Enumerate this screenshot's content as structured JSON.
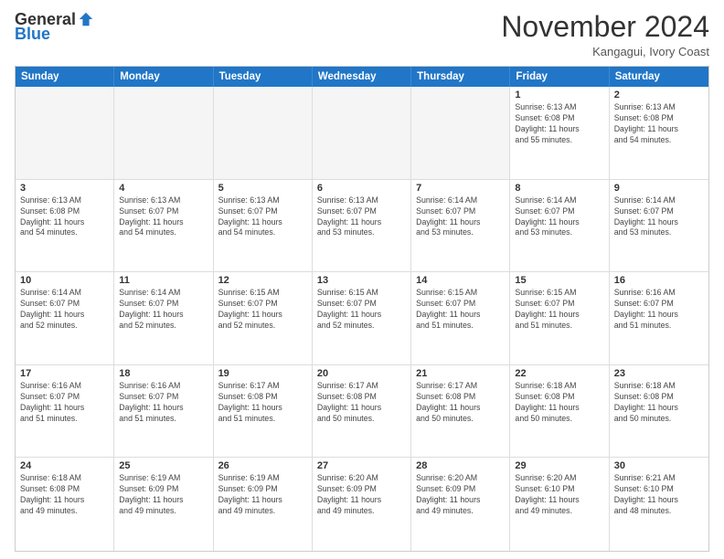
{
  "header": {
    "logo_general": "General",
    "logo_blue": "Blue",
    "month_title": "November 2024",
    "location": "Kangagui, Ivory Coast"
  },
  "calendar": {
    "days_of_week": [
      "Sunday",
      "Monday",
      "Tuesday",
      "Wednesday",
      "Thursday",
      "Friday",
      "Saturday"
    ],
    "weeks": [
      [
        {
          "day": "",
          "info": ""
        },
        {
          "day": "",
          "info": ""
        },
        {
          "day": "",
          "info": ""
        },
        {
          "day": "",
          "info": ""
        },
        {
          "day": "",
          "info": ""
        },
        {
          "day": "1",
          "info": "Sunrise: 6:13 AM\nSunset: 6:08 PM\nDaylight: 11 hours\nand 55 minutes."
        },
        {
          "day": "2",
          "info": "Sunrise: 6:13 AM\nSunset: 6:08 PM\nDaylight: 11 hours\nand 54 minutes."
        }
      ],
      [
        {
          "day": "3",
          "info": "Sunrise: 6:13 AM\nSunset: 6:08 PM\nDaylight: 11 hours\nand 54 minutes."
        },
        {
          "day": "4",
          "info": "Sunrise: 6:13 AM\nSunset: 6:07 PM\nDaylight: 11 hours\nand 54 minutes."
        },
        {
          "day": "5",
          "info": "Sunrise: 6:13 AM\nSunset: 6:07 PM\nDaylight: 11 hours\nand 54 minutes."
        },
        {
          "day": "6",
          "info": "Sunrise: 6:13 AM\nSunset: 6:07 PM\nDaylight: 11 hours\nand 53 minutes."
        },
        {
          "day": "7",
          "info": "Sunrise: 6:14 AM\nSunset: 6:07 PM\nDaylight: 11 hours\nand 53 minutes."
        },
        {
          "day": "8",
          "info": "Sunrise: 6:14 AM\nSunset: 6:07 PM\nDaylight: 11 hours\nand 53 minutes."
        },
        {
          "day": "9",
          "info": "Sunrise: 6:14 AM\nSunset: 6:07 PM\nDaylight: 11 hours\nand 53 minutes."
        }
      ],
      [
        {
          "day": "10",
          "info": "Sunrise: 6:14 AM\nSunset: 6:07 PM\nDaylight: 11 hours\nand 52 minutes."
        },
        {
          "day": "11",
          "info": "Sunrise: 6:14 AM\nSunset: 6:07 PM\nDaylight: 11 hours\nand 52 minutes."
        },
        {
          "day": "12",
          "info": "Sunrise: 6:15 AM\nSunset: 6:07 PM\nDaylight: 11 hours\nand 52 minutes."
        },
        {
          "day": "13",
          "info": "Sunrise: 6:15 AM\nSunset: 6:07 PM\nDaylight: 11 hours\nand 52 minutes."
        },
        {
          "day": "14",
          "info": "Sunrise: 6:15 AM\nSunset: 6:07 PM\nDaylight: 11 hours\nand 51 minutes."
        },
        {
          "day": "15",
          "info": "Sunrise: 6:15 AM\nSunset: 6:07 PM\nDaylight: 11 hours\nand 51 minutes."
        },
        {
          "day": "16",
          "info": "Sunrise: 6:16 AM\nSunset: 6:07 PM\nDaylight: 11 hours\nand 51 minutes."
        }
      ],
      [
        {
          "day": "17",
          "info": "Sunrise: 6:16 AM\nSunset: 6:07 PM\nDaylight: 11 hours\nand 51 minutes."
        },
        {
          "day": "18",
          "info": "Sunrise: 6:16 AM\nSunset: 6:07 PM\nDaylight: 11 hours\nand 51 minutes."
        },
        {
          "day": "19",
          "info": "Sunrise: 6:17 AM\nSunset: 6:08 PM\nDaylight: 11 hours\nand 51 minutes."
        },
        {
          "day": "20",
          "info": "Sunrise: 6:17 AM\nSunset: 6:08 PM\nDaylight: 11 hours\nand 50 minutes."
        },
        {
          "day": "21",
          "info": "Sunrise: 6:17 AM\nSunset: 6:08 PM\nDaylight: 11 hours\nand 50 minutes."
        },
        {
          "day": "22",
          "info": "Sunrise: 6:18 AM\nSunset: 6:08 PM\nDaylight: 11 hours\nand 50 minutes."
        },
        {
          "day": "23",
          "info": "Sunrise: 6:18 AM\nSunset: 6:08 PM\nDaylight: 11 hours\nand 50 minutes."
        }
      ],
      [
        {
          "day": "24",
          "info": "Sunrise: 6:18 AM\nSunset: 6:08 PM\nDaylight: 11 hours\nand 49 minutes."
        },
        {
          "day": "25",
          "info": "Sunrise: 6:19 AM\nSunset: 6:09 PM\nDaylight: 11 hours\nand 49 minutes."
        },
        {
          "day": "26",
          "info": "Sunrise: 6:19 AM\nSunset: 6:09 PM\nDaylight: 11 hours\nand 49 minutes."
        },
        {
          "day": "27",
          "info": "Sunrise: 6:20 AM\nSunset: 6:09 PM\nDaylight: 11 hours\nand 49 minutes."
        },
        {
          "day": "28",
          "info": "Sunrise: 6:20 AM\nSunset: 6:09 PM\nDaylight: 11 hours\nand 49 minutes."
        },
        {
          "day": "29",
          "info": "Sunrise: 6:20 AM\nSunset: 6:10 PM\nDaylight: 11 hours\nand 49 minutes."
        },
        {
          "day": "30",
          "info": "Sunrise: 6:21 AM\nSunset: 6:10 PM\nDaylight: 11 hours\nand 48 minutes."
        }
      ]
    ]
  }
}
